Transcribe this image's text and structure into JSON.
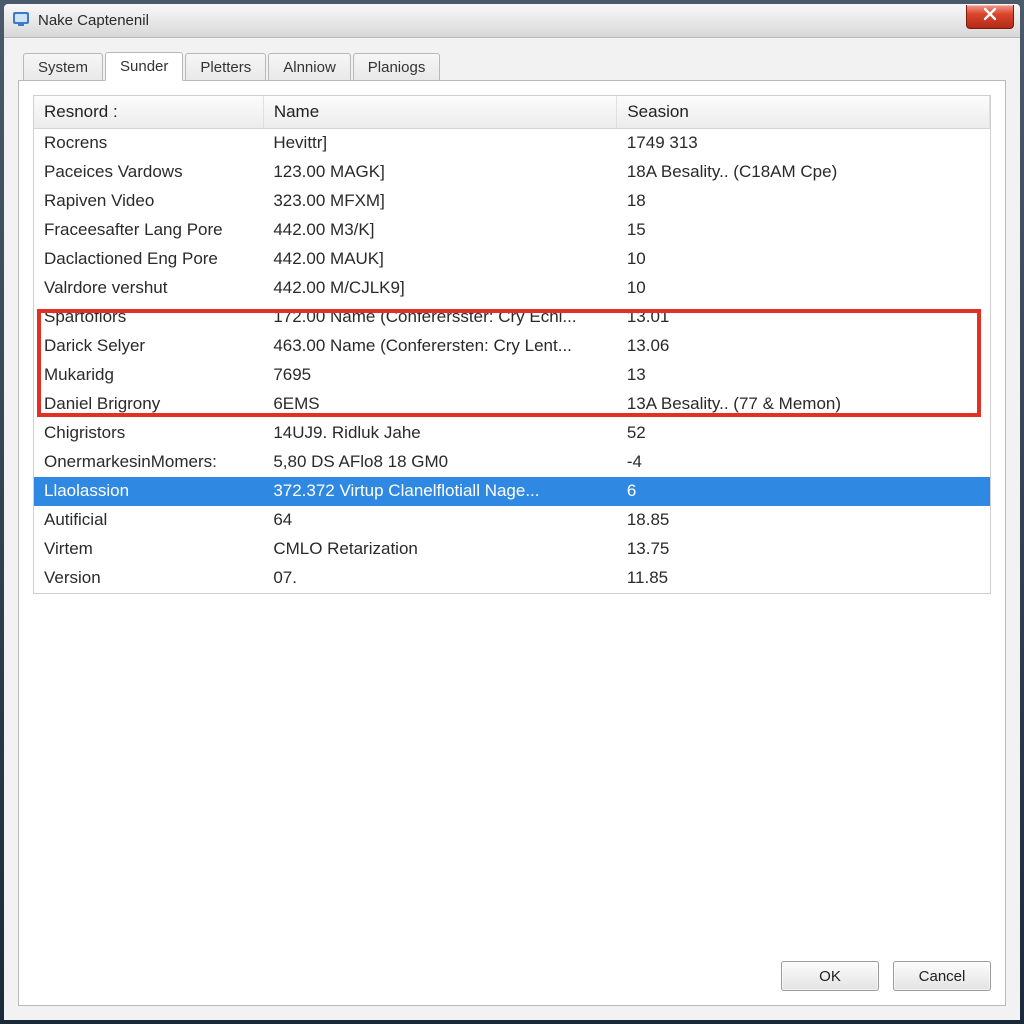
{
  "window": {
    "title": "Nake Captenenil"
  },
  "tabs": [
    {
      "label": "System"
    },
    {
      "label": "Sunder"
    },
    {
      "label": "Pletters"
    },
    {
      "label": "Alnniow"
    },
    {
      "label": "Planiogs"
    }
  ],
  "active_tab_index": 1,
  "columns": {
    "resnord": "Resnord :",
    "name": "Name",
    "seasion": "Seasion"
  },
  "rows": [
    {
      "resnord": "Rocrens",
      "name": "Hevittr]",
      "seasion": "1749 313"
    },
    {
      "resnord": "Paceices Vardows",
      "name": "123.00 MAGK]",
      "seasion": "18A Besality.. (C18AM Cpe)"
    },
    {
      "resnord": "Rapiven Video",
      "name": "323.00 MFXM]",
      "seasion": "18"
    },
    {
      "resnord": "Fraceesafter Lang Pore",
      "name": "442.00 M3/K]",
      "seasion": "15"
    },
    {
      "resnord": "Daclactioned Eng Pore",
      "name": "442.00 MAUK]",
      "seasion": "10"
    },
    {
      "resnord": "Valrdore vershut",
      "name": "442.00 M/CJLK9]",
      "seasion": "10"
    },
    {
      "resnord": "Spartoflors",
      "name": "172.00 Name (Conferersster: Cry Echl...",
      "seasion": "13.01"
    },
    {
      "resnord": "Darick Selyer",
      "name": "463.00 Name (Conferersten: Cry Lent...",
      "seasion": "13.06"
    },
    {
      "resnord": "Mukaridg",
      "name": "7695",
      "seasion": "13"
    },
    {
      "resnord": "Daniel Brigrony",
      "name": "6EMS",
      "seasion": "13A Besality.. (77 & Memon)"
    },
    {
      "resnord": "Chigristors",
      "name": "14UJ9. Ridluk Jahe",
      "seasion": "52"
    },
    {
      "resnord": "OnermarkesinMomers:",
      "name": "5,80 DS AFlo8 18 GM0",
      "seasion": "-4"
    },
    {
      "resnord": "Llaolassion",
      "name": "372.372 Virtup Clanelflotiall Nage...",
      "seasion": "6"
    },
    {
      "resnord": "Autificial",
      "name": "64",
      "seasion": "18.85"
    },
    {
      "resnord": "Virtem",
      "name": "CMLO Retarization",
      "seasion": "13.75"
    },
    {
      "resnord": "Version",
      "name": "07.",
      "seasion": "11.85"
    }
  ],
  "selected_row_index": 12,
  "highlight_rows": {
    "start": 6,
    "end": 8
  },
  "footer": {
    "ok": "OK",
    "cancel": "Cancel"
  }
}
